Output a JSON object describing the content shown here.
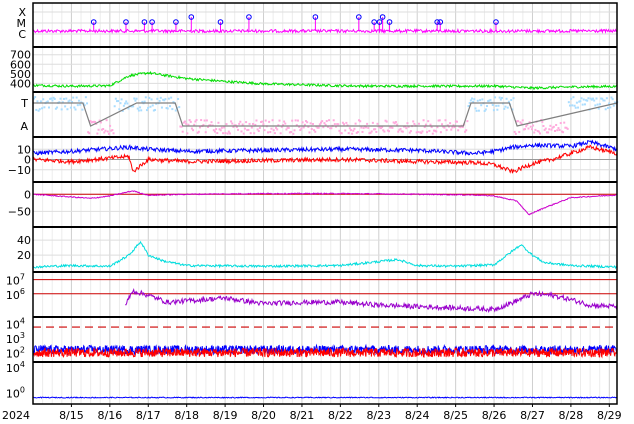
{
  "chart_data": {
    "type": "line",
    "year_label": "2024",
    "x": {
      "unit": "day",
      "start": "2024-08-14",
      "end": "2024-08-29",
      "tick_labels": [
        "8/15",
        "8/16",
        "8/17",
        "8/18",
        "8/19",
        "8/20",
        "8/21",
        "8/22",
        "8/23",
        "8/24",
        "8/25",
        "8/26",
        "8/27",
        "8/28",
        "8/29"
      ]
    },
    "grid": true,
    "panels": [
      {
        "id": "xmc",
        "y_tick_labels": [
          "X",
          "M",
          "C"
        ],
        "colors": {
          "line": "#ff00ff",
          "marker": "#0000ff"
        },
        "flare_marker_days": [
          1.58,
          2.42,
          2.9,
          3.1,
          3.72,
          4.12,
          4.88,
          5.62,
          7.35,
          8.48,
          8.88,
          9.02,
          9.1,
          9.28,
          10.52,
          10.6,
          12.05
        ],
        "flare_marker_levels": [
          "C",
          "C",
          "C",
          "C",
          "C",
          "M",
          "C",
          "M",
          "M",
          "M",
          "C",
          "C",
          "M",
          "C",
          "C",
          "C",
          "C"
        ]
      },
      {
        "id": "wind-speed",
        "y_tick_labels": [
          "700",
          "600",
          "500",
          "400"
        ],
        "ylim": [
          330,
          760
        ],
        "colors": {
          "line": "#00dd00"
        },
        "series": [
          {
            "days": [
              0,
              1,
              2,
              2.5,
              3,
              3.5,
              4,
              5,
              6,
              7,
              8,
              9,
              10,
              11,
              12,
              12.5,
              13,
              14,
              15.2
            ],
            "values": [
              380,
              370,
              375,
              480,
              510,
              480,
              450,
              420,
              395,
              385,
              375,
              370,
              372,
              370,
              372,
              360,
              350,
              362,
              368
            ]
          }
        ]
      },
      {
        "id": "sector",
        "y_tick_labels": [
          "T",
          "A"
        ],
        "colors": {
          "toward": "#aaddff",
          "away": "#ffaadd",
          "model": "#808080"
        },
        "model_series": {
          "days": [
            0,
            1.3,
            1.5,
            2.7,
            2.9,
            3.7,
            3.9,
            11.2,
            11.4,
            12.4,
            12.6,
            15.2
          ],
          "values": [
            1,
            1,
            0,
            1,
            1,
            1,
            0,
            0,
            1,
            1,
            0,
            1
          ]
        }
      },
      {
        "id": "imf",
        "y_tick_labels": [
          "10",
          "0",
          "−10"
        ],
        "ylim": [
          -20,
          20
        ],
        "colors": {
          "bt": "#0000ff",
          "bz": "#ff0000",
          "zero": "#999999"
        },
        "series": [
          {
            "key": "bt",
            "days": [
              0,
              1,
              2.5,
              3,
              4,
              6,
              8,
              10,
              11.5,
              12,
              12.5,
              13,
              14,
              14.5,
              15.2
            ],
            "values": [
              6,
              8,
              12,
              10,
              8,
              9,
              10,
              9,
              6,
              8,
              12,
              14,
              13,
              17,
              10
            ]
          },
          {
            "key": "bz",
            "days": [
              0,
              1,
              2.5,
              2.6,
              3,
              4,
              6,
              8,
              10,
              11.5,
              12,
              12.5,
              13,
              13.5,
              14,
              14.5,
              15.2
            ],
            "values": [
              0,
              -2,
              3,
              -12,
              0,
              -2,
              -1,
              0,
              -2,
              -3,
              -5,
              -12,
              -4,
              0,
              6,
              12,
              6
            ]
          }
        ]
      },
      {
        "id": "dst",
        "y_tick_labels": [
          "0",
          "−50"
        ],
        "ylim": [
          -90,
          30
        ],
        "colors": {
          "line": "#cc00cc"
        },
        "series": [
          {
            "days": [
              0,
              1,
              1.5,
              2,
              2.6,
              3,
              4,
              6,
              8,
              10,
              11.5,
              12,
              12.6,
              12.9,
              13.3,
              14,
              15.2
            ],
            "values": [
              0,
              -8,
              -12,
              -5,
              10,
              -3,
              0,
              2,
              2,
              0,
              -2,
              -5,
              -20,
              -60,
              -40,
              -10,
              -2
            ]
          }
        ]
      },
      {
        "id": "kp",
        "y_tick_labels": [
          "40",
          "20"
        ],
        "ylim": [
          0,
          55
        ],
        "colors": {
          "line": "#00dddd"
        },
        "series": [
          {
            "days": [
              0,
              1,
              2,
              2.5,
              2.8,
              3,
              3.4,
              4,
              6,
              8,
              9.5,
              10,
              11,
              12,
              12.7,
              13,
              13.3,
              14,
              15.2
            ],
            "values": [
              4,
              6,
              5,
              20,
              38,
              20,
              12,
              6,
              5,
              6,
              14,
              6,
              5,
              7,
              34,
              20,
              10,
              6,
              4
            ]
          }
        ]
      },
      {
        "id": "electron-flux",
        "y_tick_labels": [
          "10^7",
          "10^6"
        ],
        "y_log_range": [
          4.5,
          7.4
        ],
        "colors": {
          "line": "#9900cc",
          "threshold": "#cc0000"
        },
        "thresholds_log": [
          7.0,
          6.0
        ],
        "series": [
          {
            "days": [
              2.4,
              2.6,
              3,
              3.5,
              4,
              5,
              6,
              7,
              8,
              9,
              10,
              11,
              12,
              12.5,
              13,
              13.5,
              14,
              14.5,
              15.2
            ],
            "values_log": [
              5.2,
              6.2,
              5.9,
              5.4,
              5.5,
              5.7,
              5.3,
              5.4,
              5.4,
              5.2,
              5.1,
              5.0,
              4.9,
              5.4,
              6.0,
              5.9,
              5.6,
              5.2,
              5.1
            ]
          }
        ]
      },
      {
        "id": "proton-flux",
        "y_tick_labels": [
          "10^4",
          "10^3",
          "10^2"
        ],
        "y_log_range": [
          1.5,
          4.3
        ],
        "colors": {
          "p1": "#0000ff",
          "p2": "#ff0000",
          "threshold": "#cc0000"
        },
        "threshold_log": 3.75,
        "series": [
          {
            "key": "p1",
            "days": [
              0,
              15.2
            ],
            "values_log": [
              2.2,
              2.2
            ]
          },
          {
            "key": "p2",
            "days": [
              0,
              15.2
            ],
            "values_log": [
              2.0,
              2.0
            ]
          }
        ]
      },
      {
        "id": "xray",
        "y_tick_labels": [
          "10^4",
          "10^0"
        ],
        "y_log_range": [
          -1.5,
          4.5
        ],
        "colors": {
          "line": "#0000ff"
        },
        "series": [
          {
            "days": [
              0,
              15.2
            ],
            "values_log": [
              -0.8,
              -0.8
            ]
          }
        ]
      }
    ]
  }
}
